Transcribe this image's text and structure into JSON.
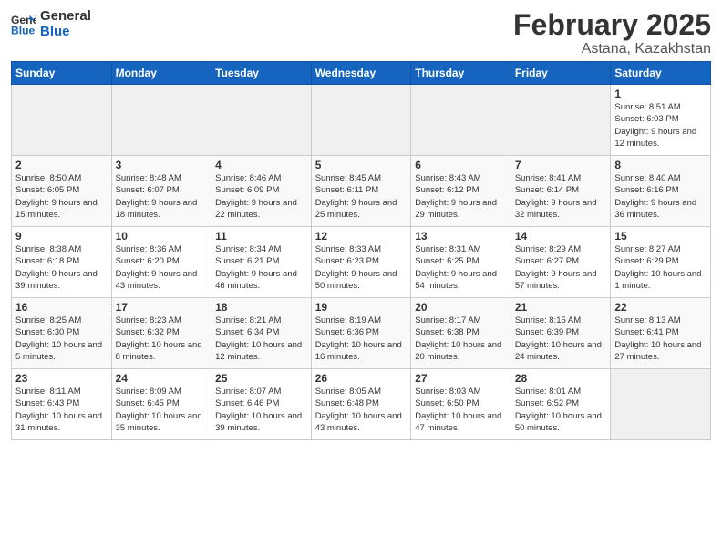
{
  "logo": {
    "line1": "General",
    "line2": "Blue"
  },
  "title": "February 2025",
  "subtitle": "Astana, Kazakhstan",
  "days_header": [
    "Sunday",
    "Monday",
    "Tuesday",
    "Wednesday",
    "Thursday",
    "Friday",
    "Saturday"
  ],
  "weeks": [
    [
      {
        "num": "",
        "info": ""
      },
      {
        "num": "",
        "info": ""
      },
      {
        "num": "",
        "info": ""
      },
      {
        "num": "",
        "info": ""
      },
      {
        "num": "",
        "info": ""
      },
      {
        "num": "",
        "info": ""
      },
      {
        "num": "1",
        "info": "Sunrise: 8:51 AM\nSunset: 6:03 PM\nDaylight: 9 hours and 12 minutes."
      }
    ],
    [
      {
        "num": "2",
        "info": "Sunrise: 8:50 AM\nSunset: 6:05 PM\nDaylight: 9 hours and 15 minutes."
      },
      {
        "num": "3",
        "info": "Sunrise: 8:48 AM\nSunset: 6:07 PM\nDaylight: 9 hours and 18 minutes."
      },
      {
        "num": "4",
        "info": "Sunrise: 8:46 AM\nSunset: 6:09 PM\nDaylight: 9 hours and 22 minutes."
      },
      {
        "num": "5",
        "info": "Sunrise: 8:45 AM\nSunset: 6:11 PM\nDaylight: 9 hours and 25 minutes."
      },
      {
        "num": "6",
        "info": "Sunrise: 8:43 AM\nSunset: 6:12 PM\nDaylight: 9 hours and 29 minutes."
      },
      {
        "num": "7",
        "info": "Sunrise: 8:41 AM\nSunset: 6:14 PM\nDaylight: 9 hours and 32 minutes."
      },
      {
        "num": "8",
        "info": "Sunrise: 8:40 AM\nSunset: 6:16 PM\nDaylight: 9 hours and 36 minutes."
      }
    ],
    [
      {
        "num": "9",
        "info": "Sunrise: 8:38 AM\nSunset: 6:18 PM\nDaylight: 9 hours and 39 minutes."
      },
      {
        "num": "10",
        "info": "Sunrise: 8:36 AM\nSunset: 6:20 PM\nDaylight: 9 hours and 43 minutes."
      },
      {
        "num": "11",
        "info": "Sunrise: 8:34 AM\nSunset: 6:21 PM\nDaylight: 9 hours and 46 minutes."
      },
      {
        "num": "12",
        "info": "Sunrise: 8:33 AM\nSunset: 6:23 PM\nDaylight: 9 hours and 50 minutes."
      },
      {
        "num": "13",
        "info": "Sunrise: 8:31 AM\nSunset: 6:25 PM\nDaylight: 9 hours and 54 minutes."
      },
      {
        "num": "14",
        "info": "Sunrise: 8:29 AM\nSunset: 6:27 PM\nDaylight: 9 hours and 57 minutes."
      },
      {
        "num": "15",
        "info": "Sunrise: 8:27 AM\nSunset: 6:29 PM\nDaylight: 10 hours and 1 minute."
      }
    ],
    [
      {
        "num": "16",
        "info": "Sunrise: 8:25 AM\nSunset: 6:30 PM\nDaylight: 10 hours and 5 minutes."
      },
      {
        "num": "17",
        "info": "Sunrise: 8:23 AM\nSunset: 6:32 PM\nDaylight: 10 hours and 8 minutes."
      },
      {
        "num": "18",
        "info": "Sunrise: 8:21 AM\nSunset: 6:34 PM\nDaylight: 10 hours and 12 minutes."
      },
      {
        "num": "19",
        "info": "Sunrise: 8:19 AM\nSunset: 6:36 PM\nDaylight: 10 hours and 16 minutes."
      },
      {
        "num": "20",
        "info": "Sunrise: 8:17 AM\nSunset: 6:38 PM\nDaylight: 10 hours and 20 minutes."
      },
      {
        "num": "21",
        "info": "Sunrise: 8:15 AM\nSunset: 6:39 PM\nDaylight: 10 hours and 24 minutes."
      },
      {
        "num": "22",
        "info": "Sunrise: 8:13 AM\nSunset: 6:41 PM\nDaylight: 10 hours and 27 minutes."
      }
    ],
    [
      {
        "num": "23",
        "info": "Sunrise: 8:11 AM\nSunset: 6:43 PM\nDaylight: 10 hours and 31 minutes."
      },
      {
        "num": "24",
        "info": "Sunrise: 8:09 AM\nSunset: 6:45 PM\nDaylight: 10 hours and 35 minutes."
      },
      {
        "num": "25",
        "info": "Sunrise: 8:07 AM\nSunset: 6:46 PM\nDaylight: 10 hours and 39 minutes."
      },
      {
        "num": "26",
        "info": "Sunrise: 8:05 AM\nSunset: 6:48 PM\nDaylight: 10 hours and 43 minutes."
      },
      {
        "num": "27",
        "info": "Sunrise: 8:03 AM\nSunset: 6:50 PM\nDaylight: 10 hours and 47 minutes."
      },
      {
        "num": "28",
        "info": "Sunrise: 8:01 AM\nSunset: 6:52 PM\nDaylight: 10 hours and 50 minutes."
      },
      {
        "num": "",
        "info": ""
      }
    ]
  ]
}
